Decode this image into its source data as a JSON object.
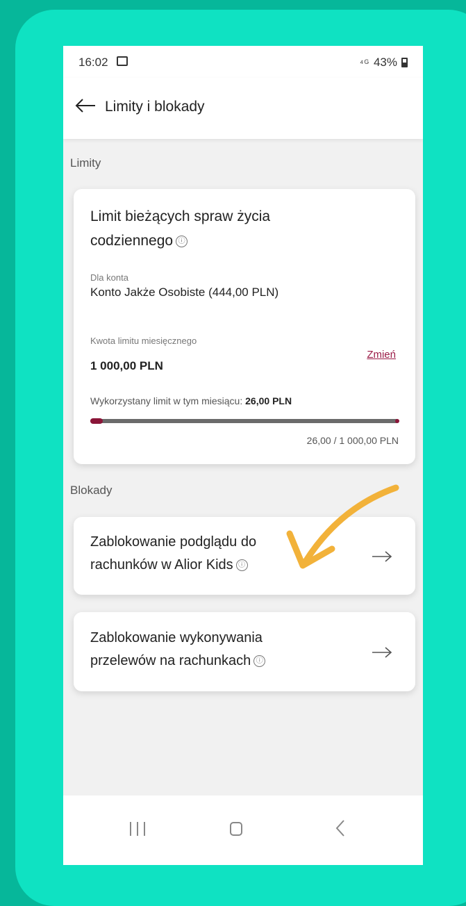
{
  "status_bar": {
    "time": "16:02",
    "signal_text": "⁴ᴳ",
    "battery": "43%"
  },
  "app_bar": {
    "title": "Limity i blokady"
  },
  "sections": {
    "limits_label": "Limity",
    "blocks_label": "Blokady"
  },
  "limit_card": {
    "title": "Limit bieżących spraw życia codziennego",
    "account_label": "Dla konta",
    "account_value": "Konto Jakże Osobiste (444,00 PLN)",
    "monthly_label": "Kwota limitu miesięcznego",
    "monthly_value": "1 000,00 PLN",
    "change_label": "Zmień",
    "used_label": "Wykorzystany limit w tym miesiącu:",
    "used_value": "26,00 PLN",
    "progress_fraction": 0.026,
    "progress_text": "26,00 / 1 000,00 PLN"
  },
  "block_cards": [
    {
      "title": "Zablokowanie podglądu do rachunków w Alior Kids"
    },
    {
      "title": "Zablokowanie wykonywania przelewów na rachunkach"
    }
  ],
  "icons": {
    "info": "ⓘ",
    "back": "arrow-left-icon",
    "forward": "arrow-right-icon"
  },
  "colors": {
    "outer_background": "#06b79a",
    "frame": "#0fe2c2",
    "accent": "#8a1538",
    "link": "#9b1c47",
    "annotation_arrow": "#f2b23a"
  }
}
